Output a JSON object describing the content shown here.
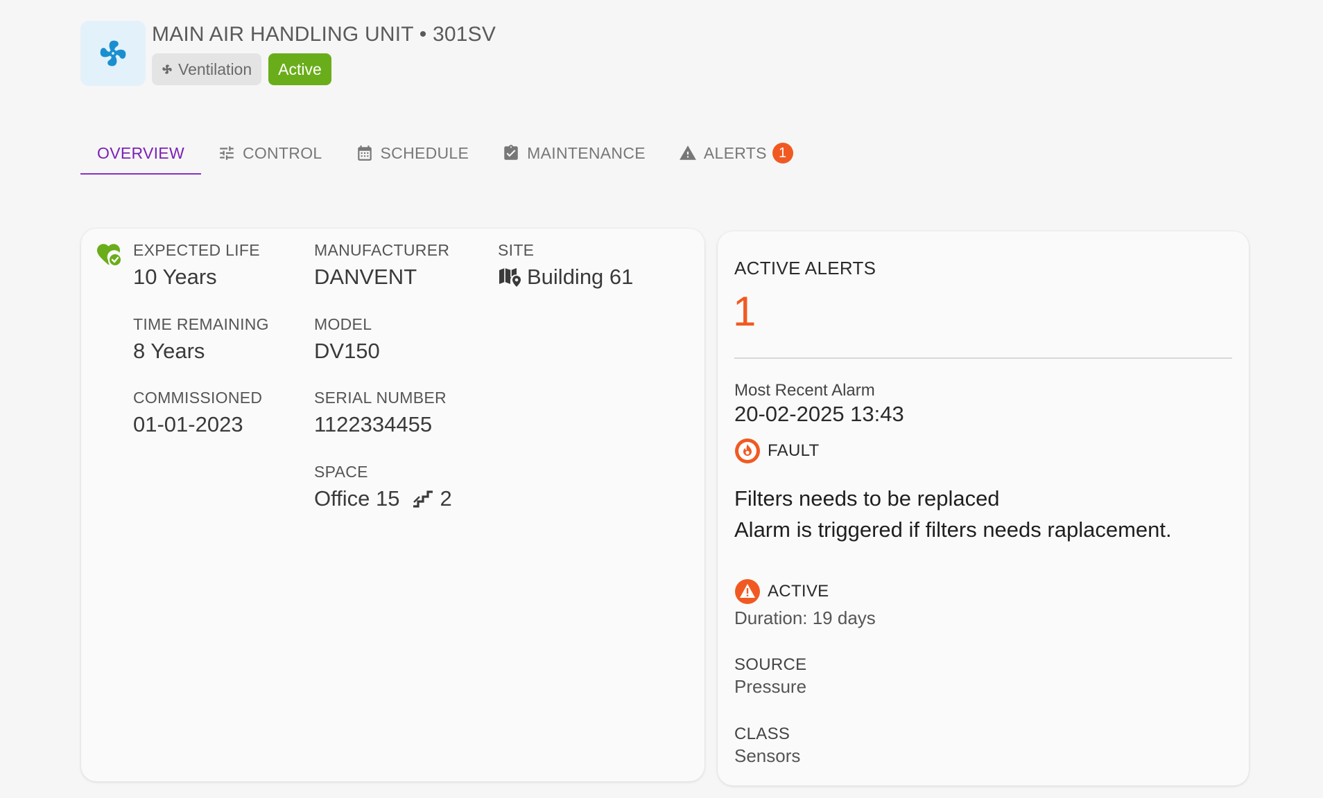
{
  "header": {
    "title": "MAIN AIR HANDLING UNIT • 301SV",
    "category_chip": "Ventilation",
    "status_chip": "Active",
    "device_icon": "fan-icon",
    "colors": {
      "avatar_bg": "#e3f1fa",
      "fan": "#1a8fd0",
      "status_chip": "#6aad1a"
    }
  },
  "tabs": [
    {
      "label": "OVERVIEW",
      "icon": "",
      "active": true
    },
    {
      "label": "CONTROL",
      "icon": "sliders-icon",
      "active": false
    },
    {
      "label": "SCHEDULE",
      "icon": "calendar-icon",
      "active": false
    },
    {
      "label": "MAINTENANCE",
      "icon": "clipboard-check-icon",
      "active": false
    },
    {
      "label": "ALERTS",
      "icon": "warning-icon",
      "active": false,
      "badge": "1"
    }
  ],
  "info": {
    "expected_life": {
      "label": "EXPECTED LIFE",
      "value": "10 Years"
    },
    "time_remaining": {
      "label": "TIME REMAINING",
      "value": "8 Years"
    },
    "commissioned": {
      "label": "COMMISSIONED",
      "value": "01-01-2023"
    },
    "manufacturer": {
      "label": "MANUFACTURER",
      "value": "DANVENT"
    },
    "model": {
      "label": "MODEL",
      "value": "DV150"
    },
    "serial_number": {
      "label": "SERIAL NUMBER",
      "value": "1122334455"
    },
    "space": {
      "label": "SPACE",
      "value": "Office 15",
      "floor": "2"
    },
    "site": {
      "label": "SITE",
      "value": "Building 61"
    }
  },
  "alerts": {
    "title": "ACTIVE ALERTS",
    "count": "1",
    "most_recent_label": "Most Recent Alarm",
    "most_recent_time": "20-02-2025 13:43",
    "severity": "FAULT",
    "alarm_title": "Filters needs to be replaced",
    "alarm_description": "Alarm is triggered if filters needs raplacement.",
    "state": "ACTIVE",
    "duration": "Duration: 19 days",
    "source_label": "SOURCE",
    "source_value": "Pressure",
    "class_label": "CLASS",
    "class_value": "Sensors",
    "accent_color": "#f05a22"
  }
}
